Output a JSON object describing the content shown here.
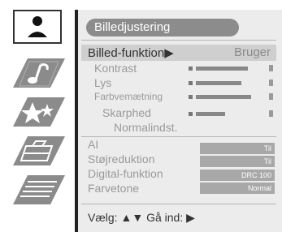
{
  "menu": {
    "title": "Billedjustering",
    "tabs": [
      {
        "name": "picture"
      },
      {
        "name": "sound"
      },
      {
        "name": "features"
      },
      {
        "name": "setup"
      },
      {
        "name": "text"
      }
    ],
    "items": {
      "picture_mode": {
        "label": "Billed-funktion▶",
        "value": "Bruger"
      },
      "contrast": {
        "label": "Kontrast",
        "level": 0.72
      },
      "brightness": {
        "label": "Lys",
        "level": 0.6
      },
      "color": {
        "label": "Farbvemætning",
        "level": 0.76
      },
      "sharpness": {
        "label": "Skarphed",
        "level": 0.42
      },
      "reset": {
        "label": "Normalindst."
      },
      "ai": {
        "label": "AI",
        "value": "Til"
      },
      "noise_reduction": {
        "label": "Støjreduktion",
        "value": "Til"
      },
      "digital": {
        "label": "Digital-funktion",
        "value": "DRC 100"
      },
      "color_tone": {
        "label": "Farvetone",
        "value": "Normal"
      }
    },
    "footer": "Vælg: ▲▼ Gå ind: ▶"
  }
}
